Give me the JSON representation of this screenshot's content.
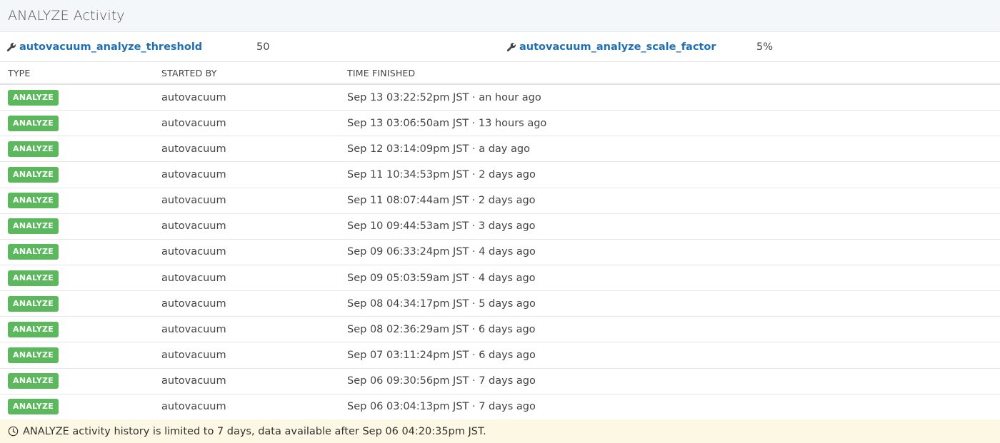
{
  "header": {
    "title": "ANALYZE Activity"
  },
  "settings": [
    {
      "name": "autovacuum_analyze_threshold",
      "value": "50",
      "icon": "wrench-icon"
    },
    {
      "name": "autovacuum_analyze_scale_factor",
      "value": "5%",
      "icon": "wrench-icon"
    }
  ],
  "table": {
    "headers": {
      "type": "TYPE",
      "started_by": "STARTED BY",
      "time_finished": "TIME FINISHED"
    },
    "rows": [
      {
        "type": "ANALYZE",
        "started_by": "autovacuum",
        "time": "Sep 13 03:22:52pm JST · an hour ago"
      },
      {
        "type": "ANALYZE",
        "started_by": "autovacuum",
        "time": "Sep 13 03:06:50am JST · 13 hours ago"
      },
      {
        "type": "ANALYZE",
        "started_by": "autovacuum",
        "time": "Sep 12 03:14:09pm JST · a day ago"
      },
      {
        "type": "ANALYZE",
        "started_by": "autovacuum",
        "time": "Sep 11 10:34:53pm JST · 2 days ago"
      },
      {
        "type": "ANALYZE",
        "started_by": "autovacuum",
        "time": "Sep 11 08:07:44am JST · 2 days ago"
      },
      {
        "type": "ANALYZE",
        "started_by": "autovacuum",
        "time": "Sep 10 09:44:53am JST · 3 days ago"
      },
      {
        "type": "ANALYZE",
        "started_by": "autovacuum",
        "time": "Sep 09 06:33:24pm JST · 4 days ago"
      },
      {
        "type": "ANALYZE",
        "started_by": "autovacuum",
        "time": "Sep 09 05:03:59am JST · 4 days ago"
      },
      {
        "type": "ANALYZE",
        "started_by": "autovacuum",
        "time": "Sep 08 04:34:17pm JST · 5 days ago"
      },
      {
        "type": "ANALYZE",
        "started_by": "autovacuum",
        "time": "Sep 08 02:36:29am JST · 6 days ago"
      },
      {
        "type": "ANALYZE",
        "started_by": "autovacuum",
        "time": "Sep 07 03:11:24pm JST · 6 days ago"
      },
      {
        "type": "ANALYZE",
        "started_by": "autovacuum",
        "time": "Sep 06 09:30:56pm JST · 7 days ago"
      },
      {
        "type": "ANALYZE",
        "started_by": "autovacuum",
        "time": "Sep 06 03:04:13pm JST · 7 days ago"
      }
    ]
  },
  "footer": {
    "icon": "clock-icon",
    "text": "ANALYZE activity history is limited to 7 days, data available after Sep 06 04:20:35pm JST."
  },
  "colors": {
    "badge_bg": "#5cb85c",
    "link": "#1f6fb2",
    "header_bg": "#f3f7fa",
    "footer_bg": "#fcf8e3"
  }
}
